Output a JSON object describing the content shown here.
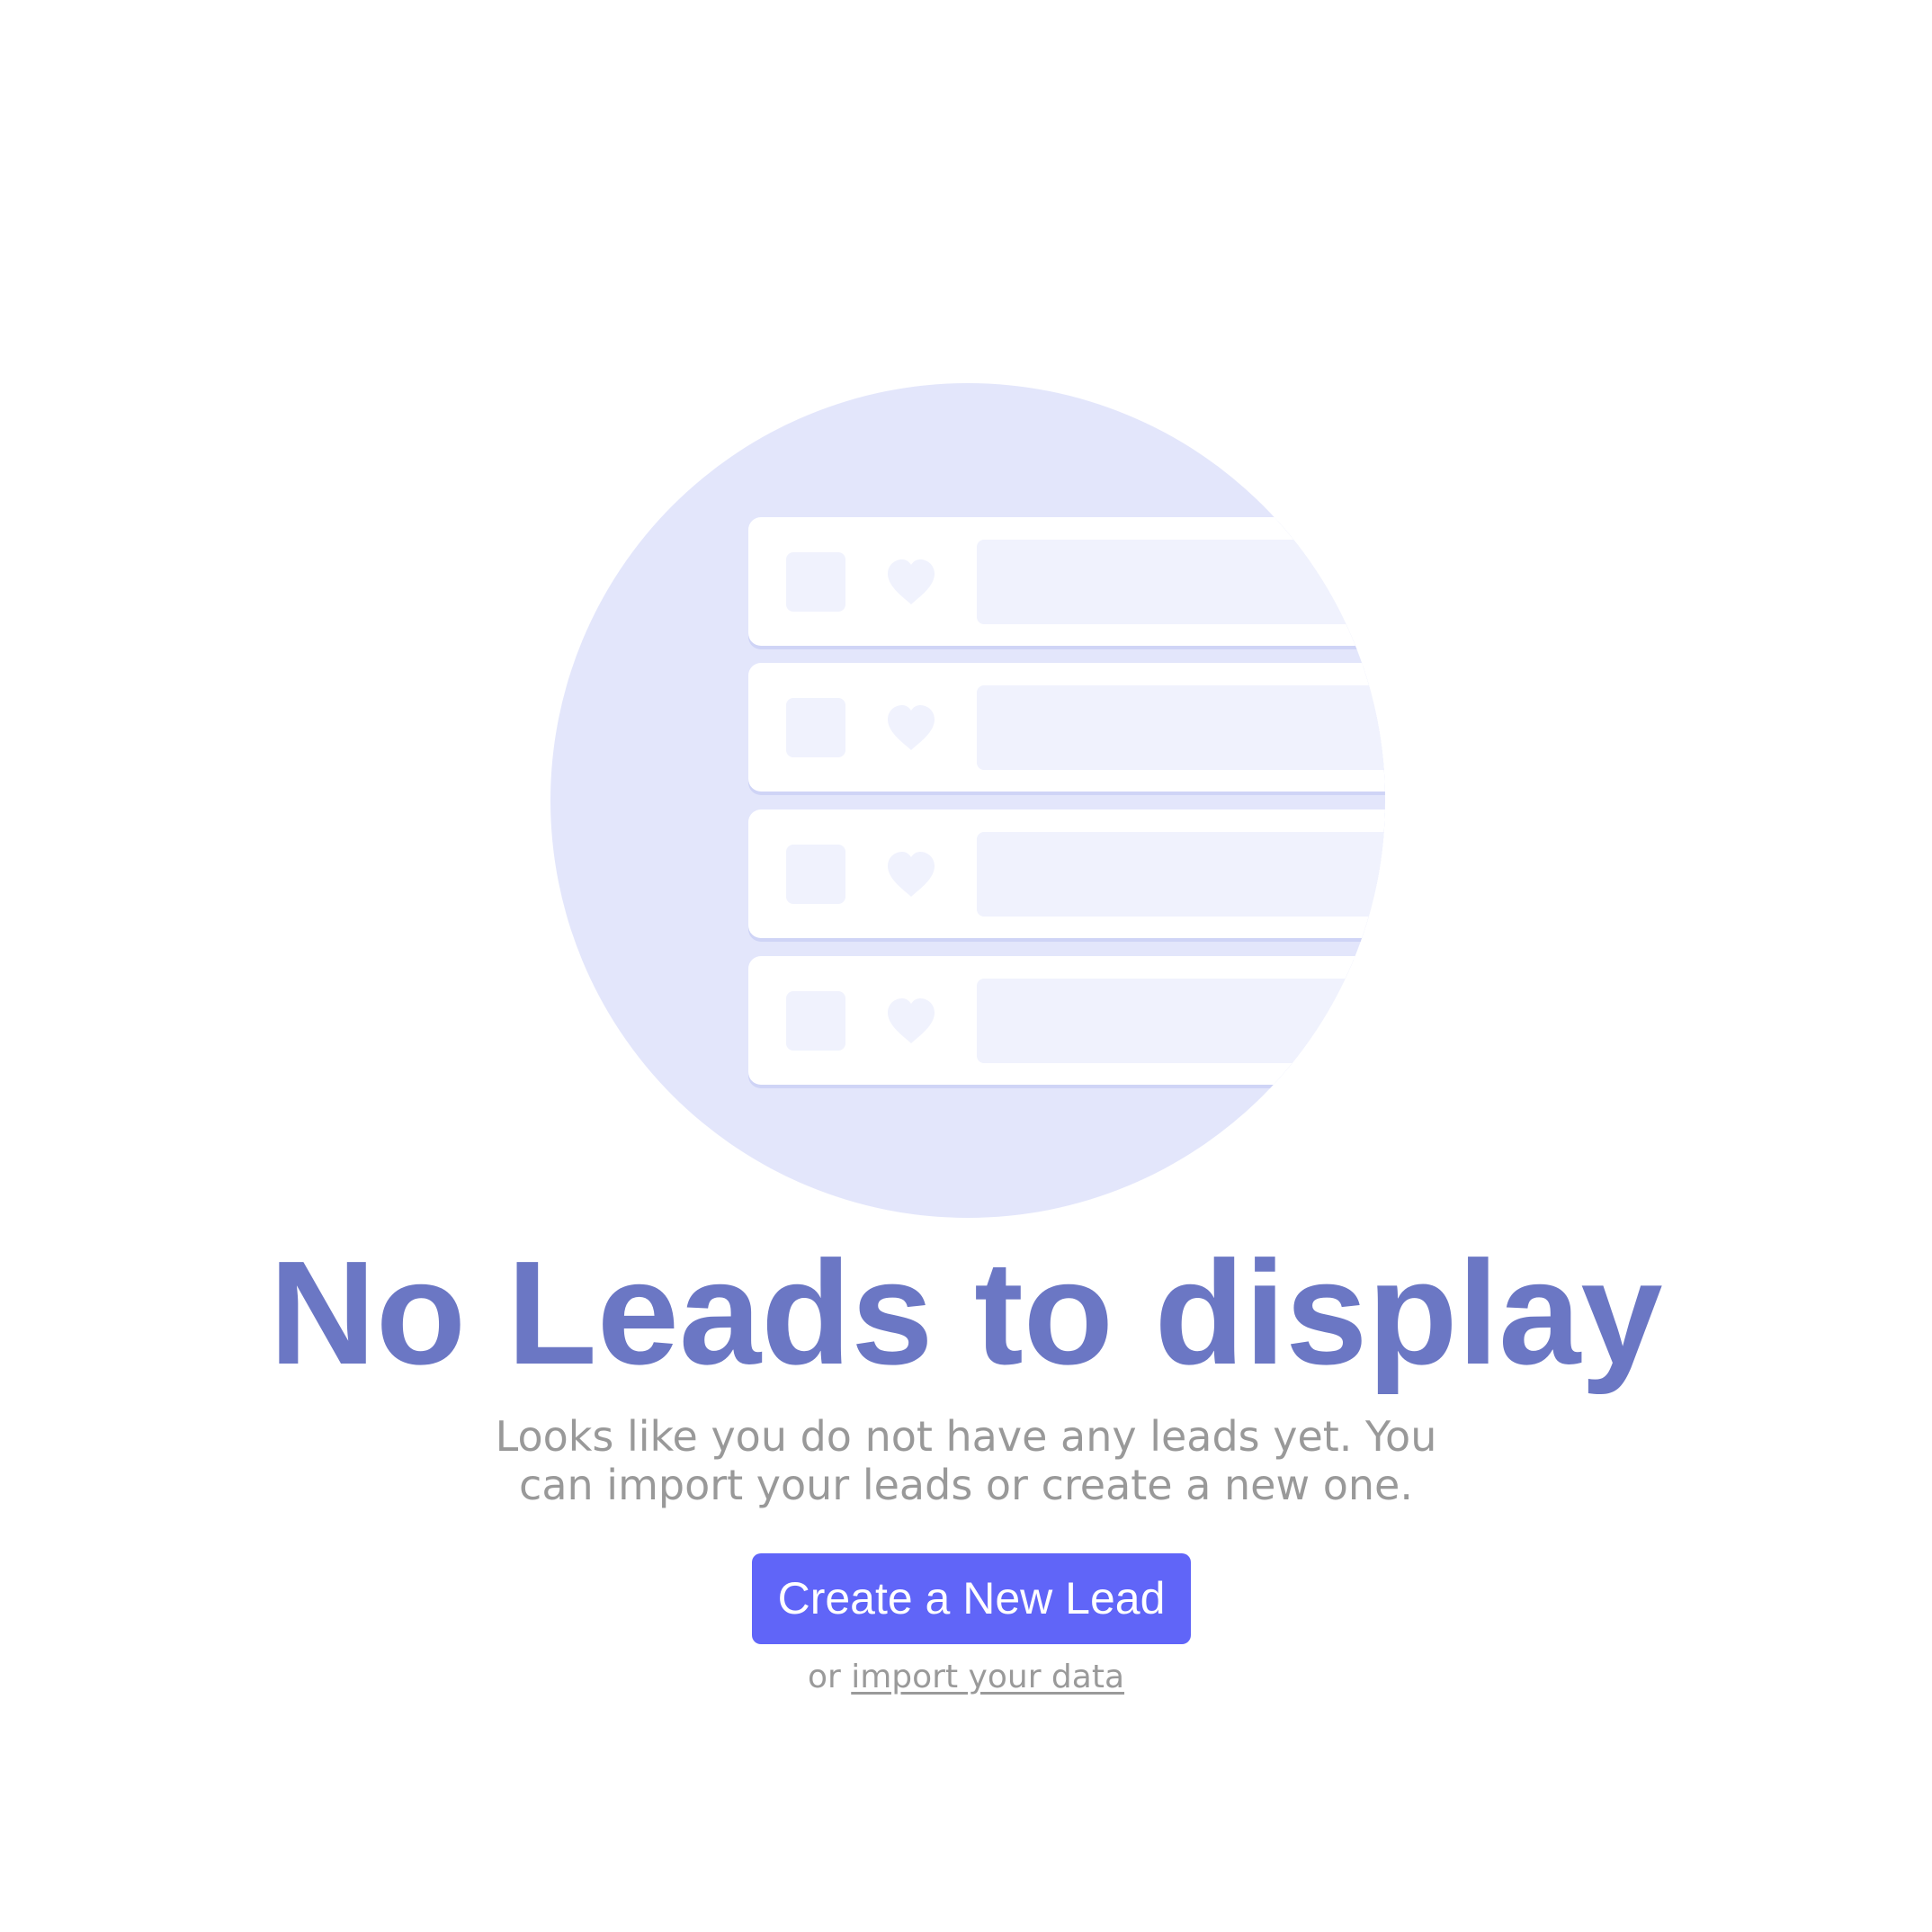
{
  "empty_state": {
    "title": "No Leads to display",
    "description": "Looks like you do not have any leads yet. You can import your leads or create a new one.",
    "primary_action_label": "Create a New Lead",
    "secondary_prefix": "or",
    "secondary_link_label": "import your data"
  },
  "illustration": {
    "icons": [
      "checkbox-placeholder-icon",
      "heart-icon"
    ],
    "placeholder_rows": 4
  },
  "colors": {
    "title": "#6b77c4",
    "primary_button": "#6065f8",
    "illustration_circle": "#e3e6fb",
    "placeholder": "#f0f2fd",
    "muted_text": "#999999"
  }
}
